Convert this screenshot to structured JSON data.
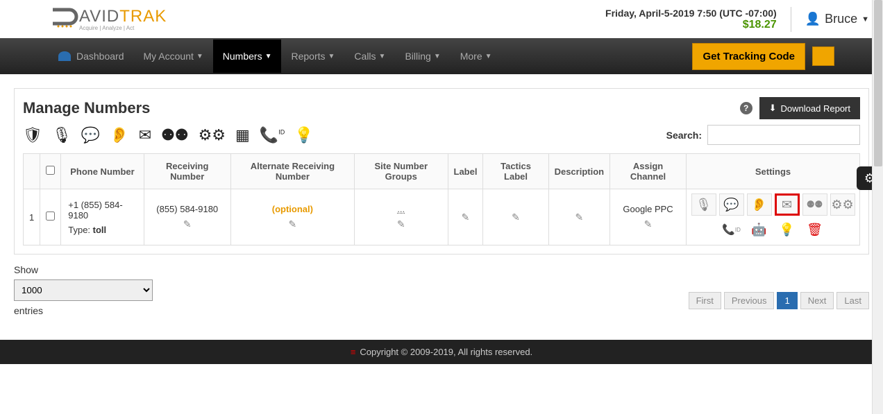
{
  "header": {
    "logo_main1": "AVID",
    "logo_main2": "TRAK",
    "logo_sub": "Acquire | Analyze | Act",
    "datetime": "Friday, April-5-2019 7:50 (UTC -07:00)",
    "balance": "$18.27",
    "user": "Bruce"
  },
  "nav": {
    "dashboard": "Dashboard",
    "my_account": "My Account",
    "numbers": "Numbers",
    "reports": "Reports",
    "calls": "Calls",
    "billing": "Billing",
    "more": "More",
    "tracking_btn": "Get Tracking Code"
  },
  "panel": {
    "title": "Manage Numbers",
    "download": "Download Report",
    "search_label": "Search:"
  },
  "table": {
    "headers": {
      "phone": "Phone Number",
      "receiving": "Receiving Number",
      "alternate": "Alternate Receiving Number",
      "site_groups": "Site Number Groups",
      "label": "Label",
      "tactics": "Tactics Label",
      "description": "Description",
      "assign": "Assign Channel",
      "settings": "Settings"
    },
    "rows": [
      {
        "index": "1",
        "phone": "+1 (855) 584-9180",
        "type_label": "Type: ",
        "type_value": "toll",
        "receiving": "(855) 584-9180",
        "alternate": "(optional)",
        "site_groups": "...",
        "assign": "Google PPC"
      }
    ]
  },
  "footer_controls": {
    "show": "Show",
    "entries": "entries",
    "page_size": "1000",
    "first": "First",
    "previous": "Previous",
    "page": "1",
    "next": "Next",
    "last": "Last"
  },
  "footer": {
    "copyright": "Copyright © 2009-2019, All rights reserved."
  }
}
